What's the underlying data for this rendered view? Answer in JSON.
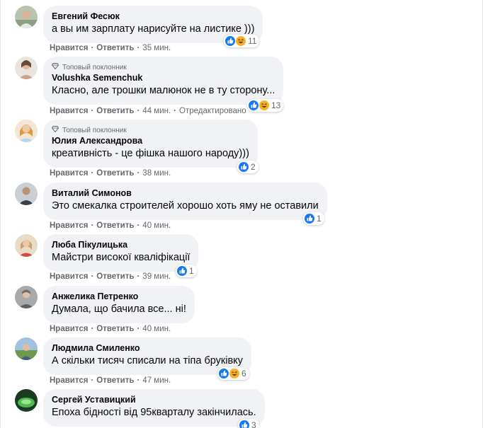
{
  "colors": {
    "like": "#1877f2",
    "haha": "#f7b125",
    "bubble": "#f0f2f5",
    "meta": "#65676b"
  },
  "badge_label": "Топовый поклонник",
  "comments": [
    {
      "name": "Евгений Фесюк",
      "text": "а вы им зарплату нарисуйте на листике )))",
      "like": "Нравится",
      "reply": "Ответить",
      "time": "35 мин.",
      "reaction_count": "11",
      "reactions": [
        "like-icon",
        "haha-icon"
      ]
    },
    {
      "name": "Volushka Semenchuk",
      "text": "Класно, але трошки малюнок не в ту сторону...",
      "like": "Нравится",
      "reply": "Ответить",
      "time": "44 мин.",
      "edited": "Отредактировано",
      "reaction_count": "13",
      "reactions": [
        "like-icon",
        "haha-icon"
      ]
    },
    {
      "name": "Юлия Александрова",
      "text": "креативність - це фішка нашого народу)))",
      "like": "Нравится",
      "reply": "Ответить",
      "time": "38 мин.",
      "reaction_count": "2",
      "reactions": [
        "like-icon"
      ]
    },
    {
      "name": "Виталий Симонов",
      "text": "Это смекалка строителей хорошо хоть яму не оставили",
      "like": "Нравится",
      "reply": "Ответить",
      "time": "40 мин.",
      "reaction_count": "1",
      "reactions": [
        "like-icon"
      ]
    },
    {
      "name": "Люба Пікулицька",
      "text": "Майстри високої кваліфікації",
      "like": "Нравится",
      "reply": "Ответить",
      "time": "39 мин.",
      "reaction_count": "1",
      "reactions": [
        "like-icon"
      ]
    },
    {
      "name": "Анжелика Петренко",
      "text": "Думала, що бачила все... ні!",
      "like": "Нравится",
      "reply": "Ответить",
      "time": "40 мин."
    },
    {
      "name": "Людмила Смиленко",
      "text": "А скільки тисяч списали на тіпа бруківку",
      "like": "Нравится",
      "reply": "Ответить",
      "time": "47 мин.",
      "reaction_count": "6",
      "reactions": [
        "like-icon",
        "haha-icon"
      ]
    },
    {
      "name": "Сергей Уставицкий",
      "text": "Епоха бідності від 95кварталу закінчилась.",
      "reaction_count": "3",
      "reactions": [
        "like-icon"
      ]
    }
  ]
}
